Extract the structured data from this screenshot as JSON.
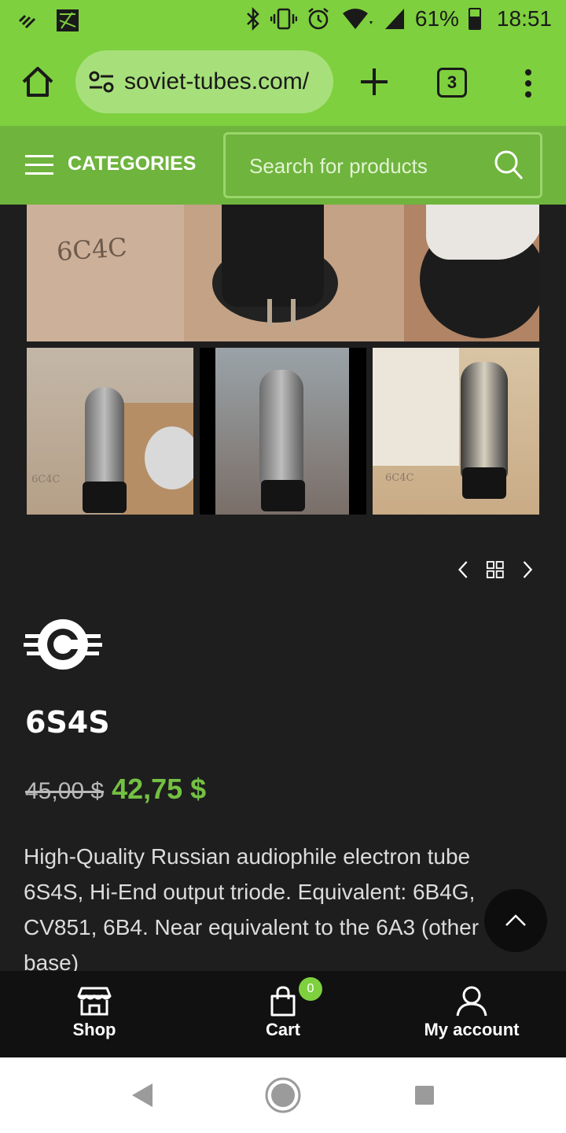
{
  "status_bar": {
    "battery_percent": "61%",
    "time": "18:51",
    "battery_level": 0.61,
    "icons": [
      "signal-bars-icon",
      "sim-icon",
      "bluetooth-icon",
      "vibrate-icon",
      "alarm-icon",
      "wifi-icon",
      "cell-signal-icon",
      "battery-icon"
    ]
  },
  "browser": {
    "url": "soviet-tubes.com/",
    "tab_count": "3"
  },
  "header": {
    "categories_label": "CATEGORIES",
    "search_placeholder": "Search for products"
  },
  "gallery": {
    "main_photo_marking": "6C4C",
    "thumb_marking_1": "6C4C",
    "thumb_marking_3": "6C4C"
  },
  "product": {
    "title": "6S4S",
    "old_price": "45,00 $",
    "new_price": "42,75 $",
    "description": "High-Quality Russian audiophile electron tube 6S4S, Hi-End output triode. Equivalent: 6B4G, CV851, 6B4. Near equivalent to the 6A3 (other base)"
  },
  "bottom_nav": {
    "shop_label": "Shop",
    "cart_label": "Cart",
    "cart_count": "0",
    "account_label": "My account"
  },
  "colors": {
    "accent_green": "#7ed03e",
    "header_green": "#6fb43d",
    "price_green": "#74c043",
    "page_bg": "#1e1e1e"
  }
}
